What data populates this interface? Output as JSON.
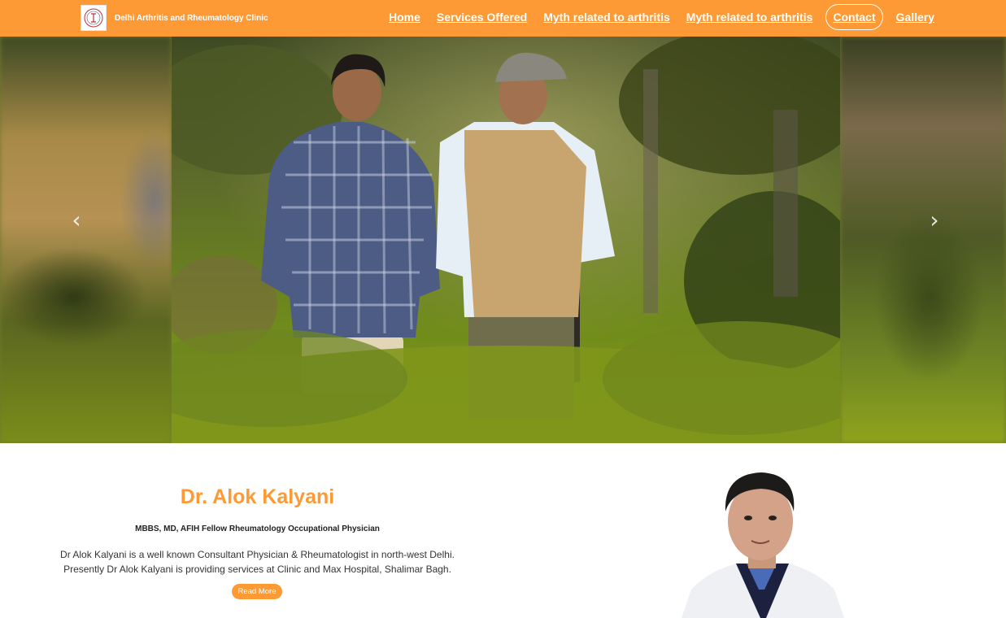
{
  "header": {
    "brand_name": "Delhi Arthritis and Rheumatology Clinic",
    "nav": [
      {
        "label": "Home",
        "active": false
      },
      {
        "label": "Services Offered",
        "active": false
      },
      {
        "label": "Myth related to arthritis",
        "active": false
      },
      {
        "label": "Myth related to arthritis",
        "active": false
      },
      {
        "label": "Contact",
        "active": true
      },
      {
        "label": "Gallery",
        "active": false
      }
    ]
  },
  "carousel": {
    "prev_icon": "chevron-left-icon",
    "next_icon": "chevron-right-icon"
  },
  "about": {
    "name": "Dr. Alok Kalyani",
    "qualifications": "MBBS, MD, AFIH Fellow Rheumatology Occupational Physician",
    "bio_line1": "Dr Alok Kalyani is a well known Consultant Physician & Rheumatologist in north-west Delhi.",
    "bio_line2": "Presently Dr Alok Kalyani is providing services at Clinic and Max Hospital, Shalimar Bagh.",
    "read_more": "Read More"
  },
  "colors": {
    "accent": "#fd9a35",
    "header_text": "#ffffff"
  }
}
